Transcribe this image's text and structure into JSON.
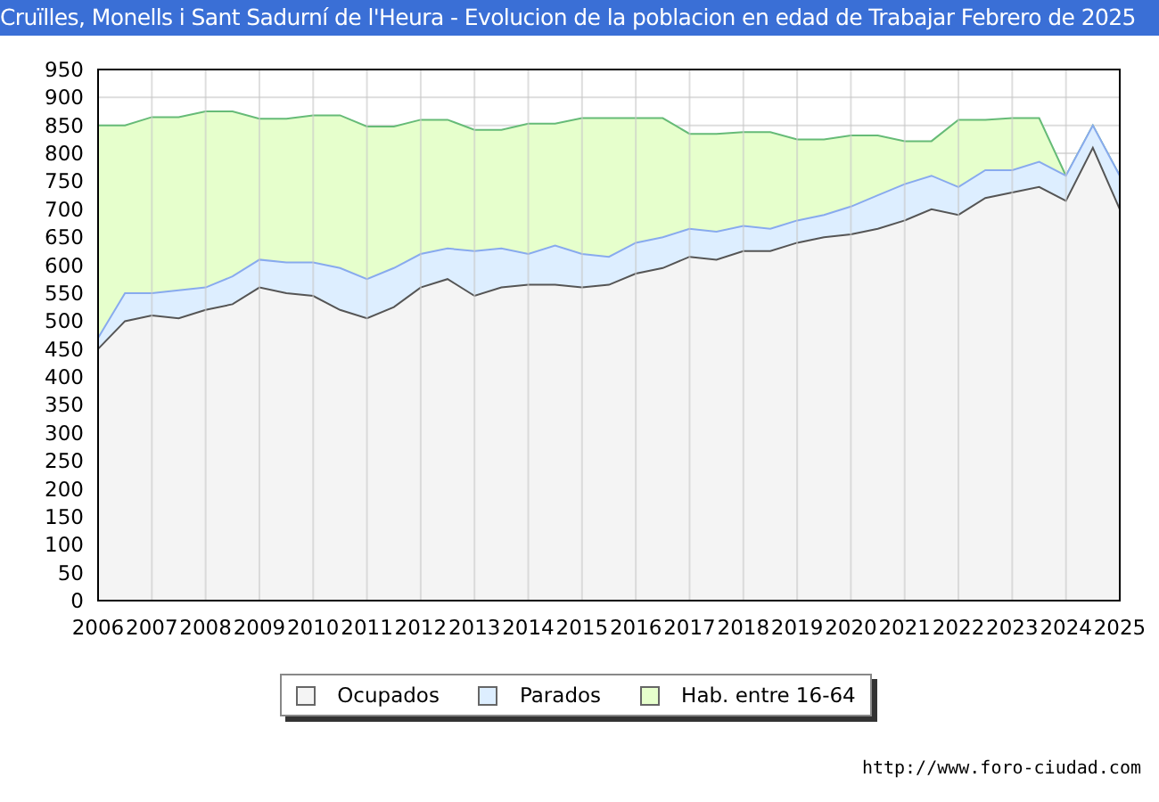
{
  "title": "Cruïlles, Monells i Sant Sadurní de l'Heura - Evolucion de la poblacion en edad de Trabajar Febrero de 2025",
  "chart_data": {
    "type": "area",
    "stacked": false,
    "grid": true,
    "xlim": [
      2006,
      2025
    ],
    "ylim": [
      0,
      950
    ],
    "xticks": [
      2006,
      2007,
      2008,
      2009,
      2010,
      2011,
      2012,
      2013,
      2014,
      2015,
      2016,
      2017,
      2018,
      2019,
      2020,
      2021,
      2022,
      2023,
      2024,
      2025
    ],
    "yticks": [
      0,
      50,
      100,
      150,
      200,
      250,
      300,
      350,
      400,
      450,
      500,
      550,
      600,
      650,
      700,
      750,
      800,
      850,
      900,
      950
    ],
    "x": [
      2006,
      2006.5,
      2007,
      2007.5,
      2008,
      2008.5,
      2009,
      2009.5,
      2010,
      2010.5,
      2011,
      2011.5,
      2012,
      2012.5,
      2013,
      2013.5,
      2014,
      2014.5,
      2015,
      2015.5,
      2016,
      2016.5,
      2017,
      2017.5,
      2018,
      2018.5,
      2019,
      2019.5,
      2020,
      2020.5,
      2021,
      2021.5,
      2022,
      2022.5,
      2023,
      2023.5,
      2024,
      2024.5,
      2025
    ],
    "series": [
      {
        "name": "Ocupados",
        "color": "#f4f4f4",
        "values": [
          450,
          500,
          510,
          505,
          520,
          530,
          560,
          550,
          545,
          520,
          505,
          525,
          560,
          575,
          545,
          560,
          565,
          565,
          560,
          565,
          585,
          595,
          615,
          610,
          625,
          625,
          640,
          650,
          655,
          665,
          680,
          700,
          690,
          720,
          730,
          740,
          715,
          810,
          700
        ]
      },
      {
        "name": "Parados",
        "color": "#ddeeff",
        "values": [
          470,
          550,
          550,
          555,
          560,
          580,
          610,
          605,
          605,
          595,
          575,
          595,
          620,
          630,
          625,
          630,
          620,
          635,
          620,
          615,
          640,
          650,
          665,
          660,
          670,
          665,
          680,
          690,
          705,
          725,
          745,
          760,
          740,
          770,
          770,
          785,
          760,
          850,
          760
        ]
      },
      {
        "name": "Hab. entre 16-64",
        "color": "#e6ffcc",
        "values": [
          850,
          850,
          865,
          865,
          875,
          875,
          862,
          862,
          868,
          868,
          848,
          848,
          860,
          860,
          842,
          842,
          853,
          853,
          863,
          863,
          863,
          863,
          835,
          835,
          838,
          838,
          825,
          825,
          832,
          832,
          822,
          822,
          860,
          860,
          863,
          863,
          760,
          850,
          760
        ]
      }
    ]
  },
  "source_url": "http://www.foro-ciudad.com"
}
